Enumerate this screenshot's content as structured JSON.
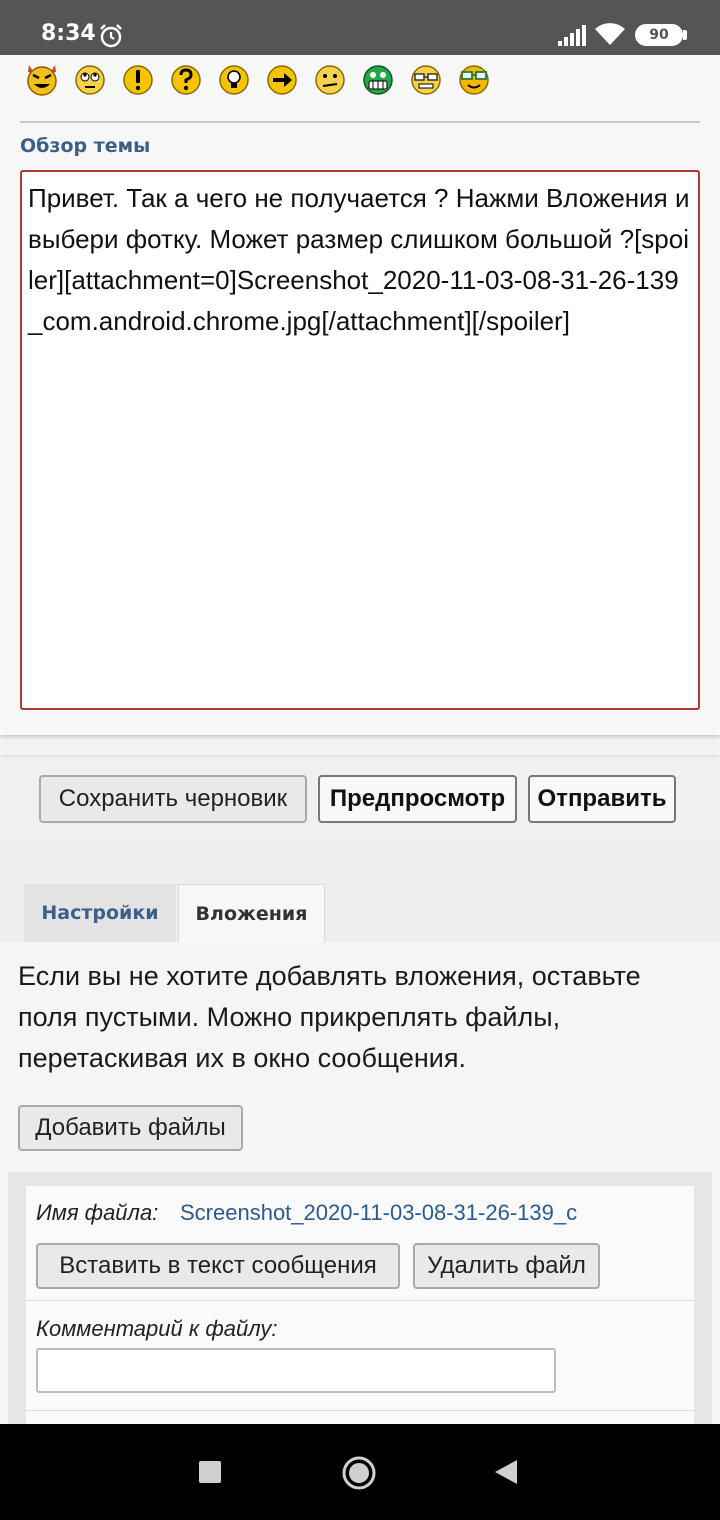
{
  "status_bar": {
    "time": "8:34",
    "battery": "90",
    "icons": [
      "alarm-icon",
      "signal-icon",
      "wifi-icon",
      "battery-icon"
    ]
  },
  "smilies": [
    "devil-smiley",
    "rolling-eyes-smiley",
    "exclamation-smiley",
    "question-smiley",
    "idea-smiley",
    "arrow-smiley",
    "neutral-smiley",
    "green-grin-smiley",
    "geek-smiley",
    "glasses-smiley"
  ],
  "editor": {
    "section_label": "Обзор темы",
    "text": "Привет. Так а чего не получается ? Нажми Вложения и выбери фотку. Может размер слишком большой ?[spoiler][attachment=0]Screenshot_2020-11-03-08-31-26-139_com.android.chrome.jpg[/attachment][/spoiler]"
  },
  "actions": {
    "save_draft": "Сохранить черновик",
    "preview": "Предпросмотр",
    "submit": "Отправить"
  },
  "tabs": {
    "settings": "Настройки",
    "attachments": "Вложения"
  },
  "attachments": {
    "info": "Если вы не хотите добавлять вложения, оставьте поля пустыми. Можно прикреплять файлы, перетаскивая их в окно сообщения.",
    "add_files": "Добавить файлы",
    "file_name_label": "Имя файла:",
    "file_name": "Screenshot_2020-11-03-08-31-26-139_c",
    "insert_button": "Вставить в текст сообщения",
    "delete_button": "Удалить файл",
    "comment_label": "Комментарий к файлу:",
    "comment_value": ""
  },
  "colors": {
    "status_bar": "#555555",
    "link": "#2b5a90",
    "section_label": "#3a5f8a",
    "editor_border": "#b0382f",
    "nav_bar": "#000000"
  }
}
